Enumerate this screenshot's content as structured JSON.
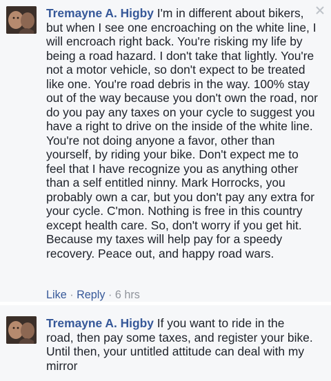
{
  "comments": [
    {
      "author": "Tremayne A. Higby",
      "body": " I'm in different about bikers,\nbut when I see one encroaching on the white line, I\nwill encroach right back. You're risking my life by\nbeing a road hazard. I don't take that lightly. You're\nnot a motor vehicle, so don't expect to be treated\nlike one. You're road debris in the way. 100% stay\nout of the way because you don't own the road, nor\ndo you pay any taxes on your cycle to suggest you\nhave a right to drive on the inside of the white line.\nYou're not doing anyone a favor, other than\nyourself, by riding your bike. Don't expect me to\nfeel that I have recognize you as anything other\nthan a self entitled ninny. Mark Horrocks, you\nprobably own a car, but you don't pay any extra for\nyour cycle. C'mon. Nothing is free in this country\nexcept health care. So, don't worry if you get hit.\nBecause my taxes will help pay for a speedy\nrecovery. Peace out, and happy road wars.",
      "like_label": "Like",
      "reply_label": "Reply",
      "separator": " · ",
      "time": "6 hrs"
    },
    {
      "author": "Tremayne A. Higby",
      "body": " If you want to ride in the\nroad, then pay some taxes, and register your bike.\nUntil then, your untitled attitude can deal with my\nmirror"
    }
  ],
  "icons": {
    "close": "close-icon"
  },
  "colors": {
    "author": "#365899",
    "meta": "#90949c",
    "background": "#f6f7f9"
  }
}
